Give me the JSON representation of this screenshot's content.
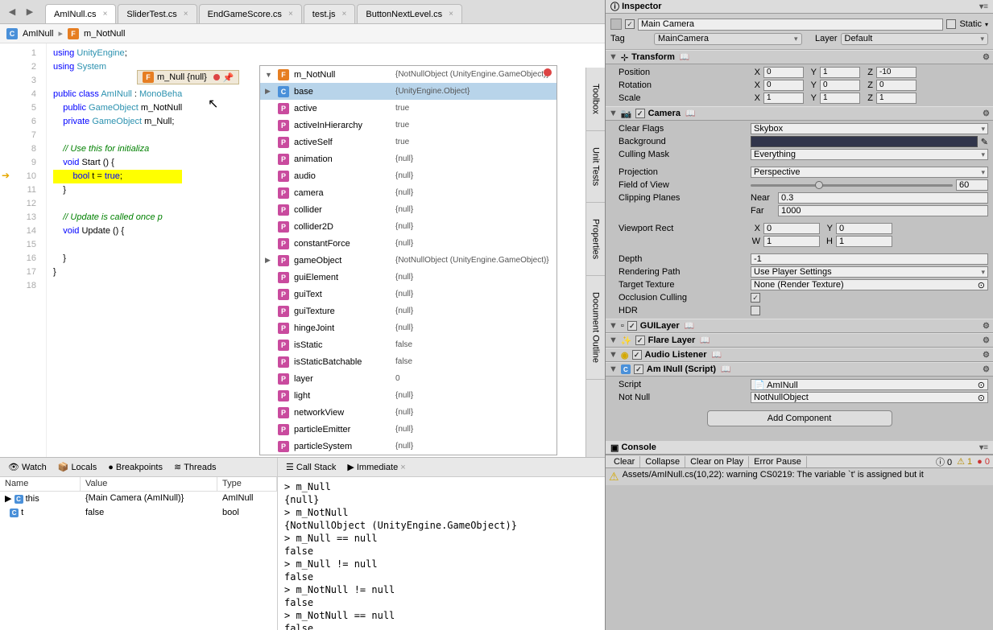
{
  "tabs": [
    "AmINull.cs",
    "SliderTest.cs",
    "EndGameScore.cs",
    "test.js",
    "ButtonNextLevel.cs"
  ],
  "active_tab": "AmINull.cs",
  "breadcrumb": {
    "class": "AmINull",
    "field": "m_NotNull"
  },
  "tooltip": "m_Null  {null}",
  "code_lines": [
    {
      "n": 1,
      "t": "using UnityEngine;"
    },
    {
      "n": 2,
      "t": "using System"
    },
    {
      "n": 3,
      "t": ""
    },
    {
      "n": 4,
      "t": "public class AmINull : MonoBeha"
    },
    {
      "n": 5,
      "t": "    public GameObject m_NotNull"
    },
    {
      "n": 6,
      "t": "    private GameObject m_Null;"
    },
    {
      "n": 7,
      "t": ""
    },
    {
      "n": 8,
      "t": "    // Use this for initializa"
    },
    {
      "n": 9,
      "t": "    void Start () {"
    },
    {
      "n": 10,
      "t": "        bool t = true;"
    },
    {
      "n": 11,
      "t": "    }"
    },
    {
      "n": 12,
      "t": ""
    },
    {
      "n": 13,
      "t": "    // Update is called once p"
    },
    {
      "n": 14,
      "t": "    void Update () {"
    },
    {
      "n": 15,
      "t": ""
    },
    {
      "n": 16,
      "t": "    }"
    },
    {
      "n": 17,
      "t": "}"
    },
    {
      "n": 18,
      "t": ""
    }
  ],
  "debug_popup": {
    "header": {
      "name": "m_NotNull",
      "val": "{NotNullObject (UnityEngine.GameObject)}"
    },
    "rows": [
      {
        "ico": "C",
        "name": "base",
        "val": "{UnityEngine.Object}",
        "sel": true,
        "exp": "▶"
      },
      {
        "ico": "P",
        "name": "active",
        "val": "true"
      },
      {
        "ico": "P",
        "name": "activeInHierarchy",
        "val": "true"
      },
      {
        "ico": "P",
        "name": "activeSelf",
        "val": "true"
      },
      {
        "ico": "P",
        "name": "animation",
        "val": "{null}"
      },
      {
        "ico": "P",
        "name": "audio",
        "val": "{null}"
      },
      {
        "ico": "P",
        "name": "camera",
        "val": "{null}"
      },
      {
        "ico": "P",
        "name": "collider",
        "val": "{null}"
      },
      {
        "ico": "P",
        "name": "collider2D",
        "val": "{null}"
      },
      {
        "ico": "P",
        "name": "constantForce",
        "val": "{null}"
      },
      {
        "ico": "P",
        "name": "gameObject",
        "val": "{NotNullObject (UnityEngine.GameObject)}",
        "exp": "▶"
      },
      {
        "ico": "P",
        "name": "guiElement",
        "val": "{null}"
      },
      {
        "ico": "P",
        "name": "guiText",
        "val": "{null}"
      },
      {
        "ico": "P",
        "name": "guiTexture",
        "val": "{null}"
      },
      {
        "ico": "P",
        "name": "hingeJoint",
        "val": "{null}"
      },
      {
        "ico": "P",
        "name": "isStatic",
        "val": "false"
      },
      {
        "ico": "P",
        "name": "isStaticBatchable",
        "val": "false"
      },
      {
        "ico": "P",
        "name": "layer",
        "val": "0"
      },
      {
        "ico": "P",
        "name": "light",
        "val": "{null}"
      },
      {
        "ico": "P",
        "name": "networkView",
        "val": "{null}"
      },
      {
        "ico": "P",
        "name": "particleEmitter",
        "val": "{null}"
      },
      {
        "ico": "P",
        "name": "particleSystem",
        "val": "{null}"
      }
    ]
  },
  "side_tabs": [
    "Toolbox",
    "Unit Tests",
    "Properties",
    "Document Outline"
  ],
  "debug_panel": {
    "tabs_left": [
      "Watch",
      "Locals",
      "Breakpoints",
      "Threads"
    ],
    "tabs_right": [
      "Call Stack",
      "Immediate"
    ],
    "headers": [
      "Name",
      "Value",
      "Type"
    ],
    "locals": [
      {
        "name": "this",
        "val": "{Main Camera (AmINull)}",
        "typ": "AmINull",
        "exp": "▶"
      },
      {
        "name": "t",
        "val": "false",
        "typ": "bool"
      }
    ],
    "immediate": "> m_Null\n{null}\n> m_NotNull\n{NotNullObject (UnityEngine.GameObject)}\n> m_Null == null\nfalse\n> m_Null != null\nfalse\n> m_NotNull != null\nfalse\n> m_NotNull == null\nfalse"
  },
  "inspector": {
    "title": "Inspector",
    "obj_name": "Main Camera",
    "static": "Static",
    "tag_label": "Tag",
    "tag_val": "MainCamera",
    "layer_label": "Layer",
    "layer_val": "Default",
    "transform": {
      "title": "Transform",
      "position": {
        "label": "Position",
        "x": "0",
        "y": "1",
        "z": "-10"
      },
      "rotation": {
        "label": "Rotation",
        "x": "0",
        "y": "0",
        "z": "0"
      },
      "scale": {
        "label": "Scale",
        "x": "1",
        "y": "1",
        "z": "1"
      }
    },
    "camera": {
      "title": "Camera",
      "clear_flags": {
        "label": "Clear Flags",
        "val": "Skybox"
      },
      "background": {
        "label": "Background"
      },
      "culling_mask": {
        "label": "Culling Mask",
        "val": "Everything"
      },
      "projection": {
        "label": "Projection",
        "val": "Perspective"
      },
      "fov": {
        "label": "Field of View",
        "val": "60"
      },
      "clipping": {
        "label": "Clipping Planes",
        "near_l": "Near",
        "near": "0.3",
        "far_l": "Far",
        "far": "1000"
      },
      "viewport": {
        "label": "Viewport Rect",
        "x": "0",
        "y": "0",
        "w": "1",
        "h": "1"
      },
      "depth": {
        "label": "Depth",
        "val": "-1"
      },
      "rendering_path": {
        "label": "Rendering Path",
        "val": "Use Player Settings"
      },
      "target_tex": {
        "label": "Target Texture",
        "val": "None (Render Texture)"
      },
      "occlusion": {
        "label": "Occlusion Culling",
        "checked": true
      },
      "hdr": {
        "label": "HDR",
        "checked": false
      }
    },
    "guilayer": "GUILayer",
    "flare": "Flare Layer",
    "audio": "Audio Listener",
    "script": {
      "title": "Am INull (Script)",
      "script_l": "Script",
      "script_v": "AmINull",
      "notnull_l": "Not Null",
      "notnull_v": "NotNullObject"
    },
    "add_comp": "Add Component"
  },
  "console": {
    "title": "Console",
    "buttons": [
      "Clear",
      "Collapse",
      "Clear on Play",
      "Error Pause"
    ],
    "counts": {
      "info": "0",
      "warn": "1",
      "err": "0"
    },
    "message": "Assets/AmINull.cs(10,22): warning CS0219: The variable `t' is assigned but it"
  }
}
